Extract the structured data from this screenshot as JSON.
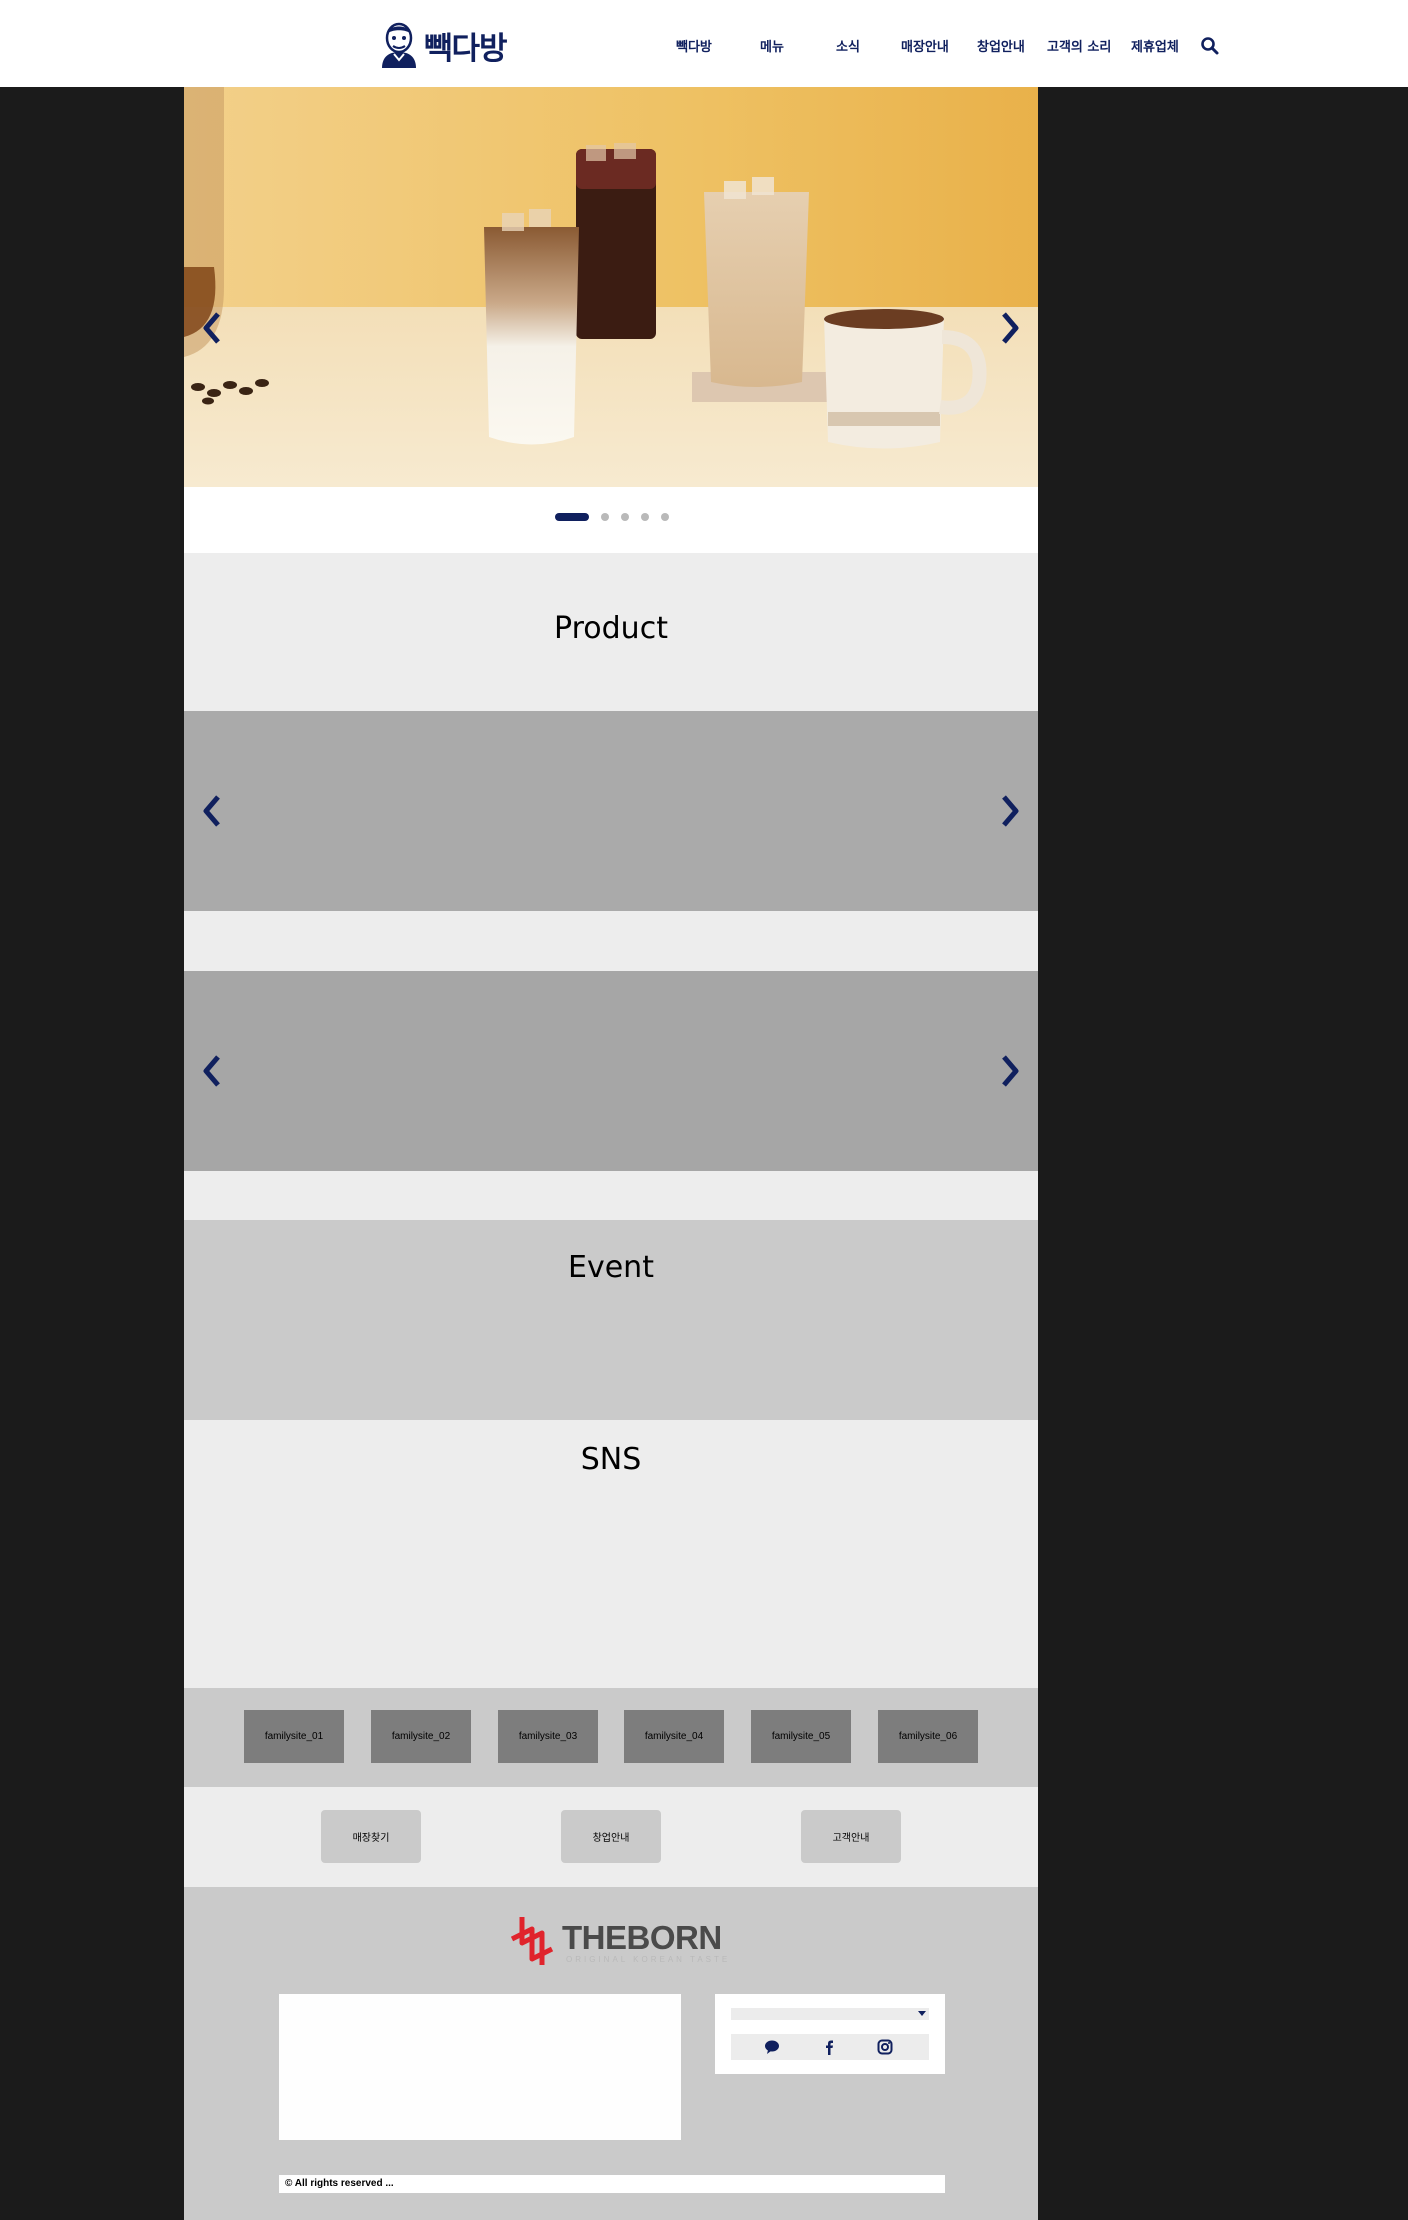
{
  "header": {
    "logo_text": "빽다방",
    "nav": [
      "빽다방",
      "메뉴",
      "소식",
      "매장안내",
      "창업안내",
      "고객의 소리",
      "제휴업체"
    ]
  },
  "hero": {
    "slide_count": 5,
    "active_slide": 1
  },
  "sections": {
    "product_title": "Product",
    "event_title": "Event",
    "sns_title": "SNS"
  },
  "family_sites": [
    "familysite_01",
    "familysite_02",
    "familysite_03",
    "familysite_04",
    "familysite_05",
    "familysite_06"
  ],
  "quick_links": [
    "매장찾기",
    "창업안내",
    "고객안내"
  ],
  "footer": {
    "brand": "THEBORN",
    "brand_sub": "ORIGINAL KOREAN TASTE",
    "copyright": "© All rights reserved ..."
  },
  "colors": {
    "accent": "#10205e",
    "hero_wall": "#eec163",
    "brand_red": "#e0242c"
  },
  "icons": [
    "search-icon",
    "chevron-left-icon",
    "chevron-right-icon",
    "kakaotalk-icon",
    "facebook-icon",
    "instagram-icon"
  ]
}
